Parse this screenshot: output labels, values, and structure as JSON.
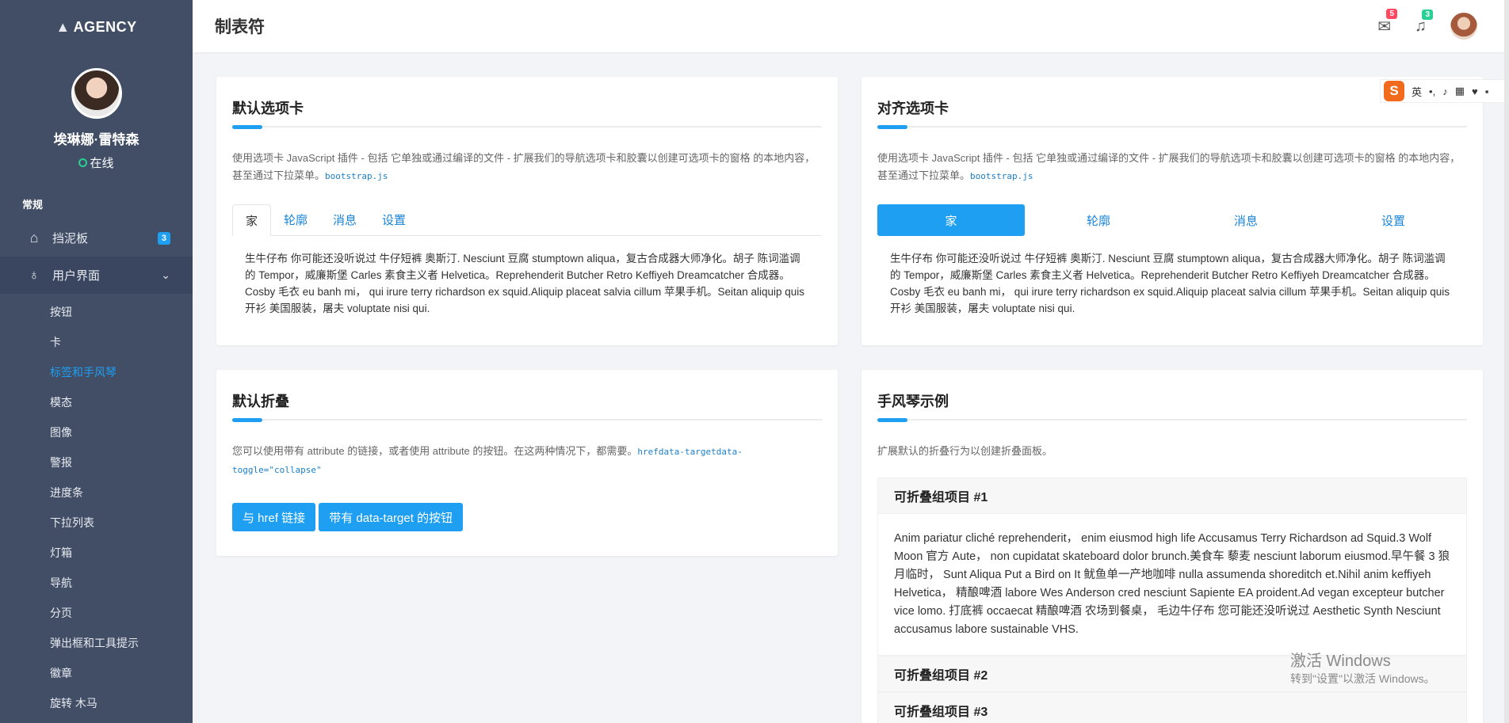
{
  "sidebar": {
    "brand": "AGENCY",
    "user_name": "埃琳娜·雷特森",
    "user_status": "在线",
    "section_label": "常规",
    "items": [
      {
        "label": "挡泥板",
        "badge": "3",
        "icon": "home-icon"
      },
      {
        "label": "用户界面",
        "icon": "lightbulb-icon"
      }
    ],
    "submenu": [
      "按钮",
      "卡",
      "标签和手风琴",
      "模态",
      "图像",
      "警报",
      "进度条",
      "下拉列表",
      "灯箱",
      "导航",
      "分页",
      "弹出框和工具提示",
      "徽章",
      "旋转 木马"
    ]
  },
  "header": {
    "title": "制表符",
    "mail_badge": "5",
    "bell_badge": "3",
    "colors": {
      "mail_badge": "#ff4961",
      "bell_badge": "#28d094"
    }
  },
  "card1": {
    "title": "默认选项卡",
    "desc": "使用选项卡 JavaScript 插件 - 包括 它单独或通过编译的文件 - 扩展我们的导航选项卡和胶囊以创建可选项卡的窗格 的本地内容，甚至通过下拉菜单。",
    "code": "bootstrap.js",
    "tabs": [
      "家",
      "轮廓",
      "消息",
      "设置"
    ],
    "content": "生牛仔布 你可能还没听说过 牛仔短裤 奥斯汀. Nesciunt 豆腐 stumptown aliqua，复古合成器大师净化。胡子 陈词滥调的 Tempor，威廉斯堡 Carles 素食主义者 Helvetica。Reprehenderit Butcher Retro Keffiyeh Dreamcatcher 合成器。Cosby 毛衣 eu banh mi， qui irure terry richardson ex squid.Aliquip placeat salvia cillum 苹果手机。Seitan aliquip quis 开衫 美国服装，屠夫 voluptate nisi qui."
  },
  "card2": {
    "title": "对齐选项卡",
    "desc": "使用选项卡 JavaScript 插件 - 包括 它单独或通过编译的文件 - 扩展我们的导航选项卡和胶囊以创建可选项卡的窗格 的本地内容，甚至通过下拉菜单。",
    "code": "bootstrap.js",
    "tabs": [
      "家",
      "轮廓",
      "消息",
      "设置"
    ],
    "content": "生牛仔布 你可能还没听说过 牛仔短裤 奥斯汀. Nesciunt 豆腐 stumptown aliqua，复古合成器大师净化。胡子 陈词滥调的 Tempor，威廉斯堡 Carles 素食主义者 Helvetica。Reprehenderit Butcher Retro Keffiyeh Dreamcatcher 合成器。Cosby 毛衣 eu banh mi， qui irure terry richardson ex squid.Aliquip placeat salvia cillum 苹果手机。Seitan aliquip quis 开衫 美国服装，屠夫 voluptate nisi qui."
  },
  "card3": {
    "title": "默认折叠",
    "desc": "您可以使用带有 attribute 的链接，或者使用 attribute 的按钮。在这两种情况下，都需要。",
    "code": "hrefdata-targetdata-toggle=\"collapse\"",
    "btn1": "与 href 链接",
    "btn2": "带有 data-target 的按钮"
  },
  "card4": {
    "title": "手风琴示例",
    "desc": "扩展默认的折叠行为以创建折叠面板。",
    "items": [
      {
        "title": "可折叠组项目 #1",
        "body": "Anim pariatur cliché reprehenderit， enim eiusmod high life Accusamus Terry Richardson ad Squid.3 Wolf Moon 官方 Aute， non cupidatat skateboard dolor brunch.美食车 藜麦 nesciunt laborum eiusmod.早午餐 3 狼月临时， Sunt Aliqua Put a Bird on It 鱿鱼单一产地咖啡 nulla assumenda shoreditch et.Nihil anim keffiyeh Helvetica， 精酿啤酒 labore Wes Anderson cred nesciunt Sapiente EA proident.Ad vegan excepteur butcher vice lomo. 打底裤 occaecat 精酿啤酒 农场到餐桌， 毛边牛仔布 您可能还没听说过 Aesthetic Synth Nesciunt accusamus labore sustainable VHS."
      },
      {
        "title": "可折叠组项目 #2"
      },
      {
        "title": "可折叠组项目 #3"
      }
    ]
  },
  "ime": {
    "lang": "英",
    "punct": "•,"
  },
  "watermark": {
    "line1": "激活 Windows",
    "line2": "转到\"设置\"以激活 Windows。"
  }
}
